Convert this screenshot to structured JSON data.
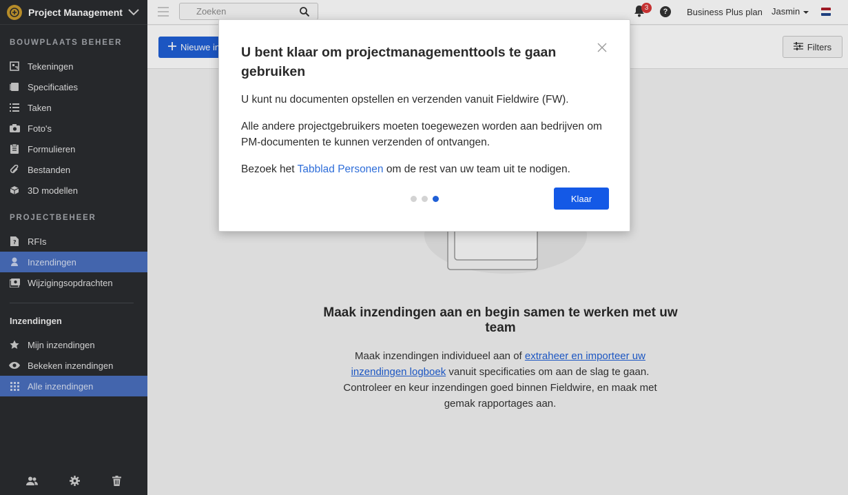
{
  "project": {
    "name": "Project Management",
    "logo_icon": "project-logo-icon"
  },
  "sidebar": {
    "section1_title": "BOUWPLAATS BEHEER",
    "section1_items": [
      {
        "label": "Tekeningen",
        "icon": "plans-icon"
      },
      {
        "label": "Specificaties",
        "icon": "specs-icon"
      },
      {
        "label": "Taken",
        "icon": "tasks-icon"
      },
      {
        "label": "Foto's",
        "icon": "camera-icon"
      },
      {
        "label": "Formulieren",
        "icon": "forms-icon"
      },
      {
        "label": "Bestanden",
        "icon": "paperclip-icon"
      },
      {
        "label": "3D modellen",
        "icon": "cube-icon"
      }
    ],
    "section2_title": "PROJECTBEHEER",
    "section2_items": [
      {
        "label": "RFIs",
        "icon": "rfi-icon"
      },
      {
        "label": "Inzendingen",
        "icon": "submittal-icon",
        "active": true
      },
      {
        "label": "Wijzigingsopdrachten",
        "icon": "change-order-icon"
      }
    ],
    "sub_heading": "Inzendingen",
    "sub_items": [
      {
        "label": "Mijn inzendingen",
        "icon": "star-icon"
      },
      {
        "label": "Bekeken inzendingen",
        "icon": "eye-icon"
      },
      {
        "label": "Alle inzendingen",
        "icon": "grid-icon",
        "active": true
      }
    ],
    "active_color": "#4a6fbf"
  },
  "topbar": {
    "search_placeholder": "Zoeken",
    "notification_count": "3",
    "help_label": "?",
    "plan": "Business Plus plan",
    "user": "Jasmin"
  },
  "toolbar": {
    "new_label": "Nieuwe in",
    "filters_label": "Filters"
  },
  "main": {
    "empty_title": "Maak inzendingen aan en begin samen te werken met uw team",
    "text_part1": "Maak inzendingen individueel aan of ",
    "text_link": "extraheer en importeer uw inzendingen logboek",
    "text_part2": " vanuit specificaties om aan de slag te gaan. Controleer en keur inzendingen goed binnen Fieldwire, en maak met gemak rapportages aan."
  },
  "modal": {
    "title": "U bent klaar om projectmanagementtools te gaan gebruiken",
    "p1": "U kunt nu documenten opstellen en verzenden vanuit Fieldwire (FW).",
    "p2": "Alle andere projectgebruikers moeten toegewezen worden aan bedrijven om PM-documenten te kunnen verzenden of ontvangen.",
    "p3_pre": "Bezoek het ",
    "p3_link": "Tabblad Personen",
    "p3_post": " om de rest van uw team uit te nodigen.",
    "step_current": 3,
    "step_total": 3,
    "done_label": "Klaar",
    "accent": "#1459e6"
  }
}
